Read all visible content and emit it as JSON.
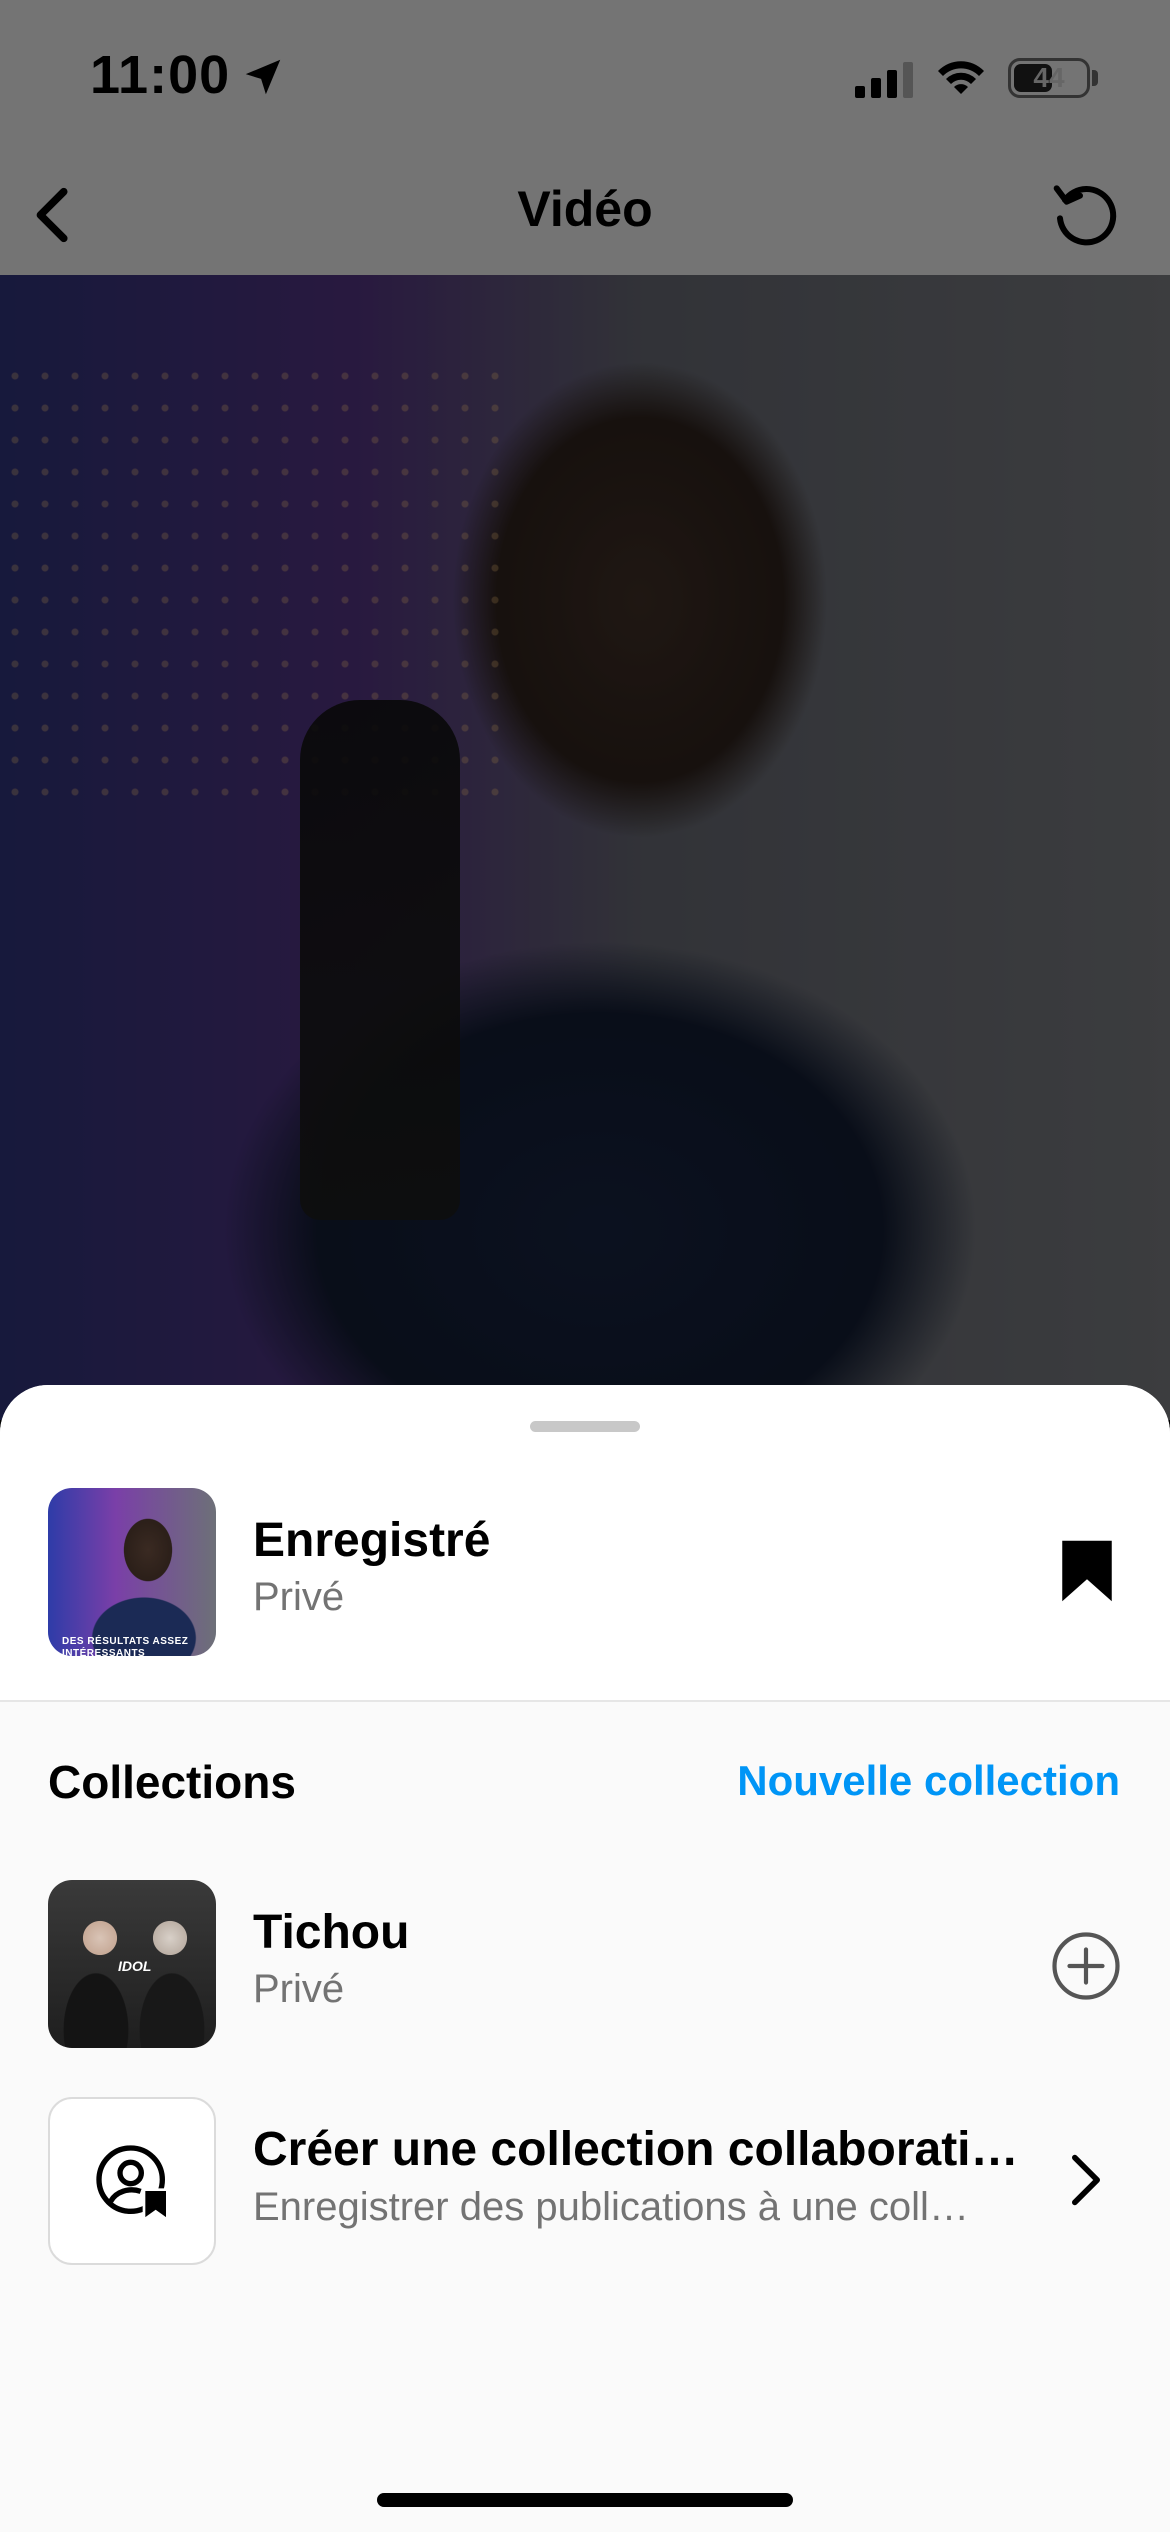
{
  "status_bar": {
    "time": "11:00",
    "battery": "44",
    "icons": [
      "location-arrow-icon",
      "signal-icon",
      "wifi-icon",
      "battery-icon"
    ]
  },
  "nav": {
    "title": "Vidéo",
    "back_icon": "chevron-left-icon",
    "replay_icon": "replay-icon"
  },
  "video": {
    "thumbnail_caption": "DES RÉSULTATS ASSEZ INTÉRESSANTS"
  },
  "saved": {
    "title": "Enregistré",
    "subtitle": "Privé",
    "icon": "bookmark-filled-icon"
  },
  "collections": {
    "header": "Collections",
    "new_label": "Nouvelle collection",
    "items": [
      {
        "title": "Tichou",
        "subtitle": "Privé",
        "thumb_text": "IDOL",
        "action_icon": "plus-circle-icon"
      }
    ],
    "collab": {
      "title": "Créer une collection collaborative",
      "subtitle": "Enregistrer des publications à une collection partagée",
      "icon": "shared-collection-icon",
      "action_icon": "chevron-right-icon"
    }
  },
  "colors": {
    "accent": "#0095f6",
    "secondary_text": "#737373",
    "sheet_bg": "#fafafa"
  }
}
